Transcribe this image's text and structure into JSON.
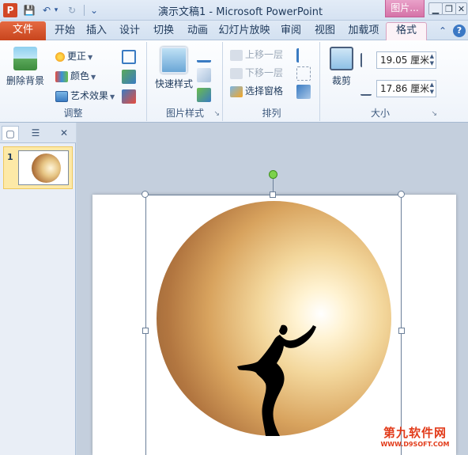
{
  "window": {
    "title": "演示文稿1 - Microsoft PowerPoint",
    "app_icon_letter": "P",
    "context_tab_header": "图片...",
    "controls": {
      "minimize": "▁",
      "restore": "❐",
      "close": "✕"
    }
  },
  "quick_access": {
    "save": "💾",
    "undo": "↶",
    "undo_dd": "▾",
    "redo": "↻",
    "customize": "⌄"
  },
  "tabs": {
    "file": "文件",
    "items": [
      "开始",
      "插入",
      "设计",
      "切换",
      "动画",
      "幻灯片放映",
      "审阅",
      "视图",
      "加载项"
    ],
    "format": "格式",
    "collapse_icon": "⌃",
    "help_icon": "?"
  },
  "ribbon": {
    "adjust": {
      "label": "调整",
      "remove_bg": "删除背景",
      "corrections": "更正",
      "color": "颜色",
      "artistic": "艺术效果"
    },
    "styles": {
      "label": "图片样式",
      "quick_styles": "快速样式"
    },
    "arrange": {
      "label": "排列",
      "bring_forward": "上移一层",
      "send_backward": "下移一层",
      "selection_pane": "选择窗格"
    },
    "size": {
      "label": "大小",
      "crop": "裁剪",
      "height": "19.05 厘米",
      "width": "17.86 厘米"
    }
  },
  "slides_pane": {
    "tab_slides_icon": "▢",
    "tab_outline_icon": "☰",
    "close_icon": "✕",
    "slide_number": "1"
  },
  "colors": {
    "file_tab": "#d24726",
    "context_tab": "#d573a8",
    "rotation_handle": "#7cd24b"
  },
  "watermark": {
    "main": "第九软件网",
    "sub": "WWW.D9SOFT.COM"
  }
}
